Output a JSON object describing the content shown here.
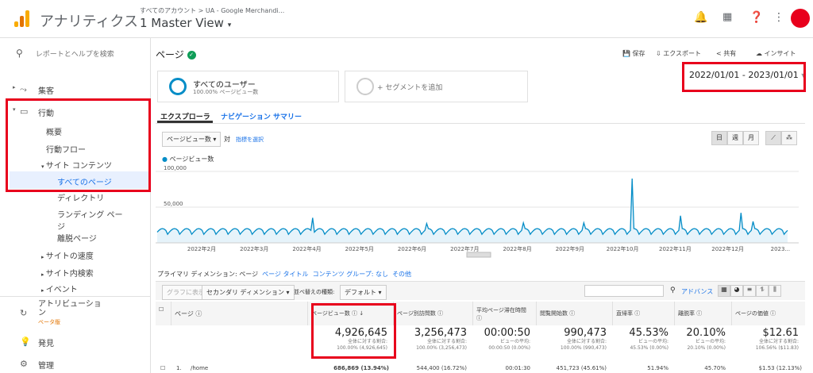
{
  "header": {
    "app_name": "アナリティクス",
    "account_path": "すべてのアカウント > UA - Google Merchandi...",
    "view_name": "1 Master View"
  },
  "sidebar": {
    "search_placeholder": "レポートとヘルプを検索",
    "items": {
      "acquisition": "集客",
      "behavior": "行動",
      "overview": "概要",
      "behavior_flow": "行動フロー",
      "site_content": "サイト コンテンツ",
      "all_pages": "すべてのページ",
      "directory": "ディレクトリ",
      "landing_pages": "ランディング ペー",
      "landing_pages_2": "ジ",
      "exit_pages": "離脱ページ",
      "site_speed": "サイトの速度",
      "site_search": "サイト内検索",
      "events": "イベント",
      "attribution": "アトリビューショ",
      "attribution_2": "ン",
      "beta": "ベータ版",
      "discover": "発見",
      "admin": "管理"
    }
  },
  "main": {
    "page_title": "ページ",
    "actions": {
      "save": "保存",
      "export": "エクスポート",
      "share": "共有",
      "insights": "インサイト"
    },
    "segment_all_users": "すべてのユーザー",
    "segment_sub": "100.00% ページビュー数",
    "segment_add": "+ セグメントを追加",
    "date_range": "2022/01/01 - 2023/01/01",
    "tabs": {
      "explorer": "エクスプローラ",
      "nav_summary": "ナビゲーション サマリー"
    },
    "metric_dropdown": "ページビュー数",
    "vs": "対",
    "select_metric": "指標を選択",
    "period_buttons": [
      "日",
      "週",
      "月"
    ],
    "legend_label": "ページビュー数",
    "primary_dim_label": "プライマリ ディメンション:",
    "primary_dims": [
      "ページ",
      "ページ タイトル",
      "コンテンツ グループ: なし",
      "その他"
    ],
    "plot_rows": "グラフに表示",
    "secondary_dim": "セカンダリ ディメンション",
    "sort_type_label": "並べ替えの種類:",
    "sort_type": "デフォルト",
    "advanced": "アドバンス"
  },
  "chart_data": {
    "type": "line",
    "series": [
      {
        "name": "ページビュー数",
        "color": "#058dc7"
      }
    ],
    "x_ticks": [
      "2022年2月",
      "2022年3月",
      "2022年4月",
      "2022年5月",
      "2022年6月",
      "2022年7月",
      "2022年8月",
      "2022年9月",
      "2022年10月",
      "2022年11月",
      "2022年12月",
      "2023..."
    ],
    "y_ticks": [
      "100,000",
      "50,000"
    ],
    "ylim": [
      0,
      100000
    ],
    "baseline": 15000,
    "weekly_peak": 20000,
    "spikes": [
      {
        "date": "2022/04/01",
        "value": 35000
      },
      {
        "date": "2022/06/06",
        "value": 27000
      },
      {
        "date": "2022/08/01",
        "value": 28000
      },
      {
        "date": "2022/09/05",
        "value": 28000
      },
      {
        "date": "2022/10/03",
        "value": 90000
      },
      {
        "date": "2022/10/31",
        "value": 38000
      },
      {
        "date": "2022/12/05",
        "value": 42000
      },
      {
        "date": "2022/12/12",
        "value": 30000
      }
    ]
  },
  "table": {
    "headers": [
      "ページ",
      "ページビュー数",
      "ページ別訪問数",
      "平均ページ滞在時間",
      "閲覧開始数",
      "直帰率",
      "離脱率",
      "ページの価値"
    ],
    "totals": [
      {
        "value": "4,926,645",
        "sub1": "全体に対する割合:",
        "sub2": "100.00% (4,926,645)"
      },
      {
        "value": "3,256,473",
        "sub1": "全体に対する割合:",
        "sub2": "100.00% (3,256,473)"
      },
      {
        "value": "00:00:50",
        "sub1": "ビューの平均:",
        "sub2": "00:00:50 (0.00%)"
      },
      {
        "value": "990,473",
        "sub1": "全体に対する割合:",
        "sub2": "100.00% (990,473)"
      },
      {
        "value": "45.53%",
        "sub1": "ビューの平均:",
        "sub2": "45.53% (0.00%)"
      },
      {
        "value": "20.10%",
        "sub1": "ビューの平均:",
        "sub2": "20.10% (0.00%)"
      },
      {
        "value": "$12.61",
        "sub1": "全体に対する割合:",
        "sub2": "106.56% ($11.83)"
      }
    ],
    "row1": [
      "1.",
      "/home",
      "686,869 (13.94%)",
      "544,400 (16.72%)",
      "00:01:30",
      "451,723 (45.61%)",
      "51.94%",
      "45.70%",
      "$1.53 (12.13%)"
    ]
  }
}
